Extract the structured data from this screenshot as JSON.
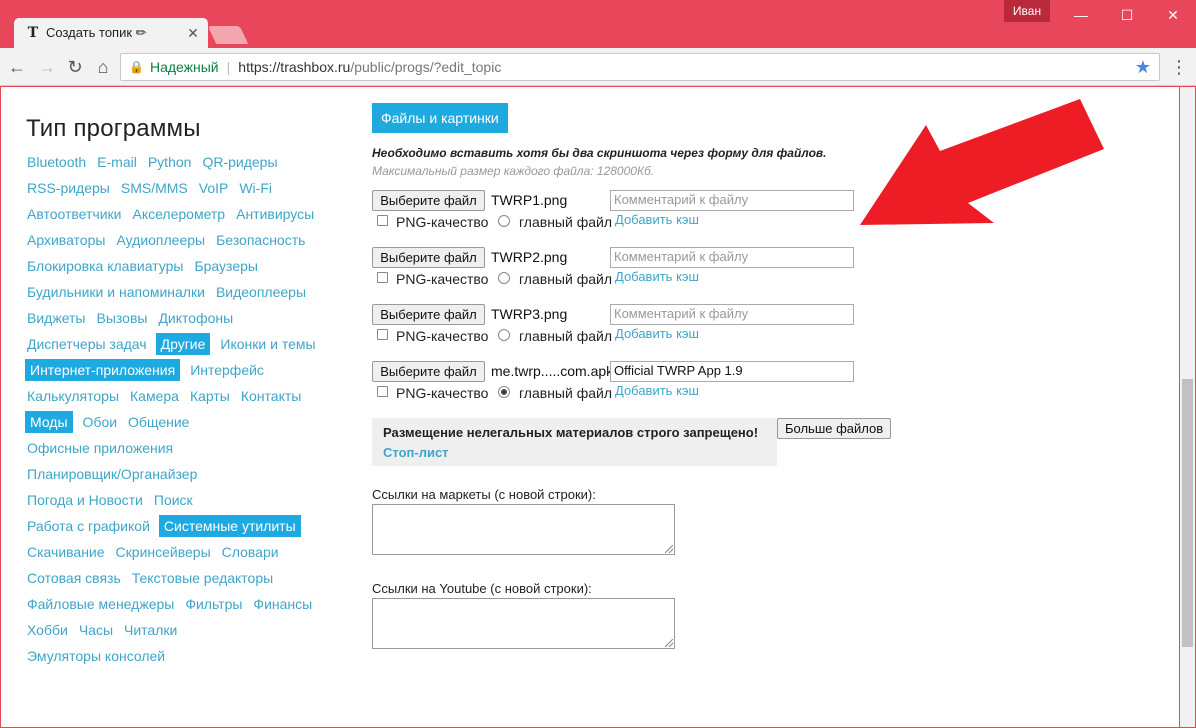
{
  "browser": {
    "tab_title": "Создать топик ✏",
    "tab_favicon": "T",
    "user_badge": "Иван",
    "secure_label": "Надежный",
    "url_host": "https://trashbox.ru",
    "url_path": "/public/progs/?edit_topic"
  },
  "sidebar": {
    "title": "Тип программы",
    "rows": [
      [
        {
          "label": "Bluetooth"
        },
        {
          "label": "E-mail"
        },
        {
          "label": "Python"
        },
        {
          "label": "QR-ридеры"
        }
      ],
      [
        {
          "label": "RSS-ридеры"
        },
        {
          "label": "SMS/MMS"
        },
        {
          "label": "VoIP"
        },
        {
          "label": "Wi-Fi"
        }
      ],
      [
        {
          "label": "Автоответчики"
        },
        {
          "label": "Акселерометр"
        },
        {
          "label": "Антивирусы"
        }
      ],
      [
        {
          "label": "Архиваторы"
        },
        {
          "label": "Аудиоплееры"
        },
        {
          "label": "Безопасность"
        }
      ],
      [
        {
          "label": "Блокировка клавиатуры"
        },
        {
          "label": "Браузеры"
        }
      ],
      [
        {
          "label": "Будильники и напоминалки"
        },
        {
          "label": "Видеоплееры"
        }
      ],
      [
        {
          "label": "Виджеты"
        },
        {
          "label": "Вызовы"
        },
        {
          "label": "Диктофоны"
        }
      ],
      [
        {
          "label": "Диспетчеры задач"
        },
        {
          "label": "Другие",
          "active": true
        },
        {
          "label": "Иконки и темы"
        }
      ],
      [
        {
          "label": "Интернет-приложения",
          "active": true
        },
        {
          "label": "Интерфейс"
        }
      ],
      [
        {
          "label": "Калькуляторы"
        },
        {
          "label": "Камера"
        },
        {
          "label": "Карты"
        },
        {
          "label": "Контакты"
        }
      ],
      [
        {
          "label": "Моды",
          "active": true
        },
        {
          "label": "Обои"
        },
        {
          "label": "Общение"
        }
      ],
      [
        {
          "label": "Офисные приложения"
        }
      ],
      [
        {
          "label": "Планировщик/Органайзер"
        }
      ],
      [
        {
          "label": "Погода и Новости"
        },
        {
          "label": "Поиск"
        }
      ],
      [
        {
          "label": "Работа с графикой"
        },
        {
          "label": "Системные утилиты",
          "active": true
        }
      ],
      [
        {
          "label": "Скачивание"
        },
        {
          "label": "Скринсейверы"
        },
        {
          "label": "Словари"
        }
      ],
      [
        {
          "label": "Сотовая связь"
        },
        {
          "label": "Текстовые редакторы"
        }
      ],
      [
        {
          "label": "Файловые менеджеры"
        },
        {
          "label": "Фильтры"
        },
        {
          "label": "Финансы"
        }
      ],
      [
        {
          "label": "Хобби"
        },
        {
          "label": "Часы"
        },
        {
          "label": "Читалки"
        }
      ],
      [
        {
          "label": "Эмуляторы консолей"
        }
      ]
    ]
  },
  "files": {
    "section_button": "Файлы и картинки",
    "notice": "Необходимо вставить хотя бы два скриншота через форму для файлов.",
    "subnotice": "Максимальный размер каждого файла: 128000Кб.",
    "choose_label": "Выберите файл",
    "png_label": "PNG-качество",
    "main_label": "главный файл",
    "cache_label": "Добавить кэш",
    "comment_placeholder": "Комментарий к файлу",
    "items": [
      {
        "filename": "TWRP1.png",
        "comment": "",
        "main": false
      },
      {
        "filename": "TWRP2.png",
        "comment": "",
        "main": false
      },
      {
        "filename": "TWRP3.png",
        "comment": "",
        "main": false
      },
      {
        "filename": "me.twrp.....com.apk",
        "comment": "Official TWRP App 1.9",
        "main": true
      }
    ],
    "warning": "Размещение нелегальных материалов строго запрещено!",
    "stoplist": "Стоп-лист",
    "more_button": "Больше файлов"
  },
  "links": {
    "markets_label": "Ссылки на маркеты (с новой строки):",
    "youtube_label": "Ссылки на Youtube (с новой строки):"
  },
  "colors": {
    "accent": "#1fa9e1",
    "link": "#3fa5c8",
    "window_frame": "#e8465a",
    "arrow": "#ee1c25"
  }
}
